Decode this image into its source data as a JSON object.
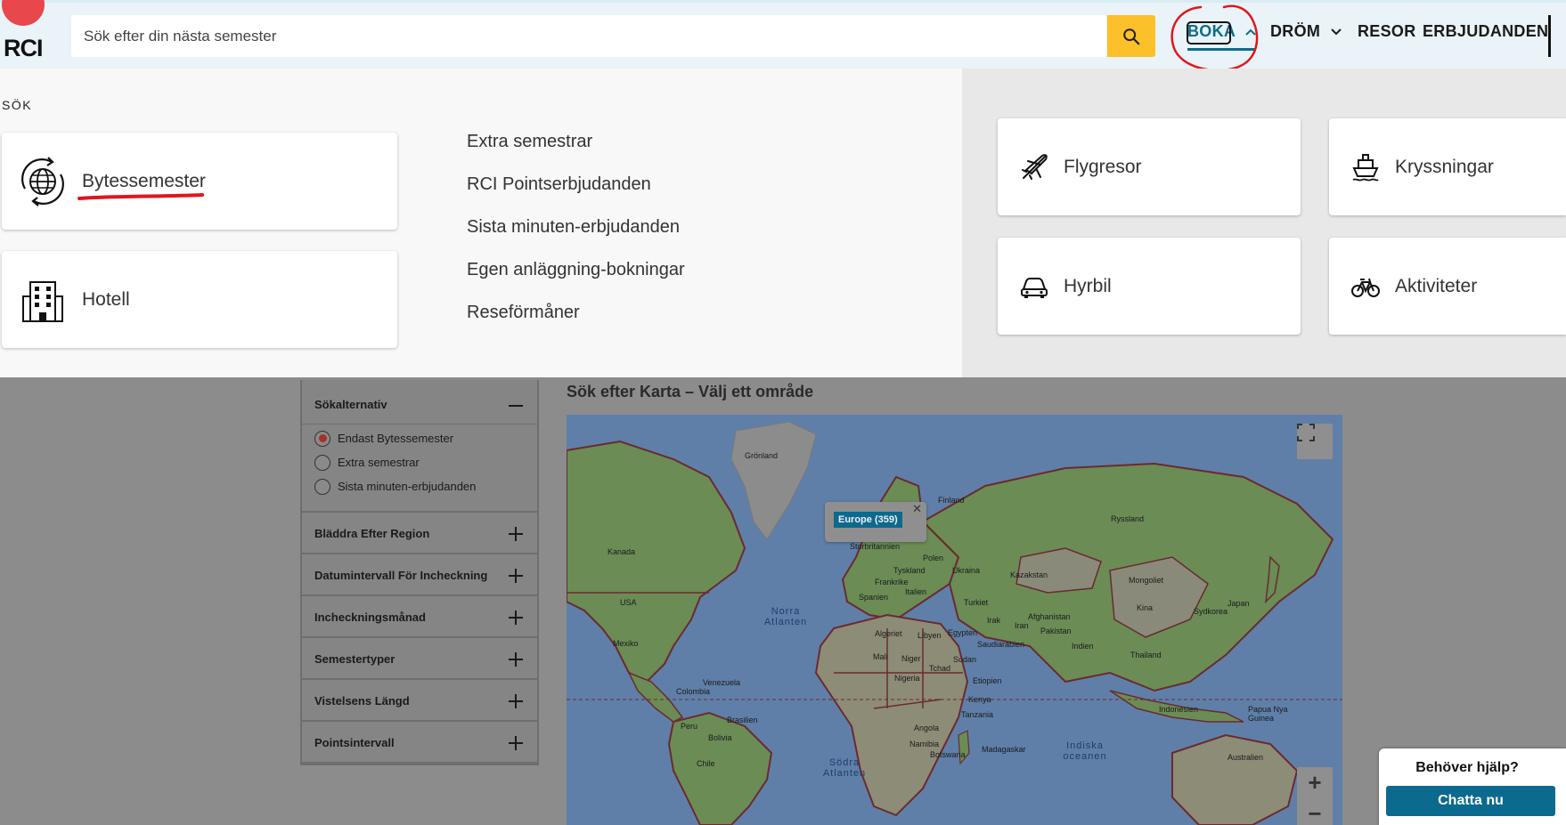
{
  "header": {
    "logo_text": "RCI",
    "search_placeholder": "Sök efter din nästa semester",
    "nav": {
      "boka": "BOKA",
      "drom": "DRÖM",
      "resor": "RESOR",
      "erbjudanden": "ERBJUDANDEN"
    }
  },
  "dropdown": {
    "section_label": "SÖK",
    "cards": {
      "bytessemester": "Bytessemester",
      "hotell": "Hotell"
    },
    "links": [
      "Extra semestrar",
      "RCI Pointserbjudanden",
      "Sista minuten-erbjudanden",
      "Egen anläggning-bokningar",
      "Reseförmåner"
    ],
    "right_cards": {
      "flygresor": "Flygresor",
      "kryssningar": "Kryssningar",
      "hyrbil": "Hyrbil",
      "aktiviteter": "Aktiviteter"
    }
  },
  "sidebar": {
    "title": "Sökalternativ",
    "options": [
      {
        "label": "Endast Bytessemester",
        "selected": true
      },
      {
        "label": "Extra semestrar",
        "selected": false
      },
      {
        "label": "Sista minuten-erbjudanden",
        "selected": false
      }
    ],
    "accordions": [
      "Bläddra Efter Region",
      "Datumintervall För Incheckning",
      "Incheckningsmånad",
      "Semestertyper",
      "Vistelsens Längd",
      "Pointsintervall"
    ]
  },
  "map": {
    "title": "Sök efter Karta – Välj ett område",
    "popup_label": "Europe (359)",
    "countries": {
      "gronland": "Grönland",
      "kanada": "Kanada",
      "usa": "USA",
      "mexiko": "Mexiko",
      "finland": "Finland",
      "ryssland": "Ryssland",
      "storbritannien": "Storbritannien",
      "polen": "Polen",
      "ukraina": "Ukraina",
      "tyskland": "Tyskland",
      "frankrike": "Frankrike",
      "italien": "Italien",
      "spanien": "Spanien",
      "turkiet": "Turkiet",
      "kazakstan": "Kazakstan",
      "mongoliet": "Mongoliet",
      "kina": "Kina",
      "sydkorea": "Sydkorea",
      "japan": "Japan",
      "afghanistan": "Afghanistan",
      "pakistan": "Pakistan",
      "indien": "Indien",
      "iran": "Iran",
      "irak": "Irak",
      "saudiarabien": "Saudiarabien",
      "egypten": "Egypten",
      "algeriet": "Algeriet",
      "libyen": "Libyen",
      "mali": "Mali",
      "niger": "Niger",
      "tchad": "Tchad",
      "sudan": "Sudan",
      "nigeria": "Nigeria",
      "etiopien": "Etiopien",
      "kenya": "Kenya",
      "tanzania": "Tanzania",
      "angola": "Angola",
      "namibia": "Namibia",
      "botswana": "Botswana",
      "madagaskar": "Madagaskar",
      "venezuela": "Venezuela",
      "colombia": "Colombia",
      "peru": "Peru",
      "brasilien": "Brasilien",
      "bolivia": "Bolivia",
      "chile": "Chile",
      "thailand": "Thailand",
      "indonesien": "Indonesien",
      "papua": "Papua Nya Guinea",
      "australien": "Australien"
    },
    "oceans": {
      "north_atlantic": "Norra Atlanten",
      "south_atlantic": "Södra Atlanten",
      "indian": "Indiska oceanen"
    }
  },
  "help": {
    "question": "Behöver hjälp?",
    "button": "Chatta nu"
  }
}
